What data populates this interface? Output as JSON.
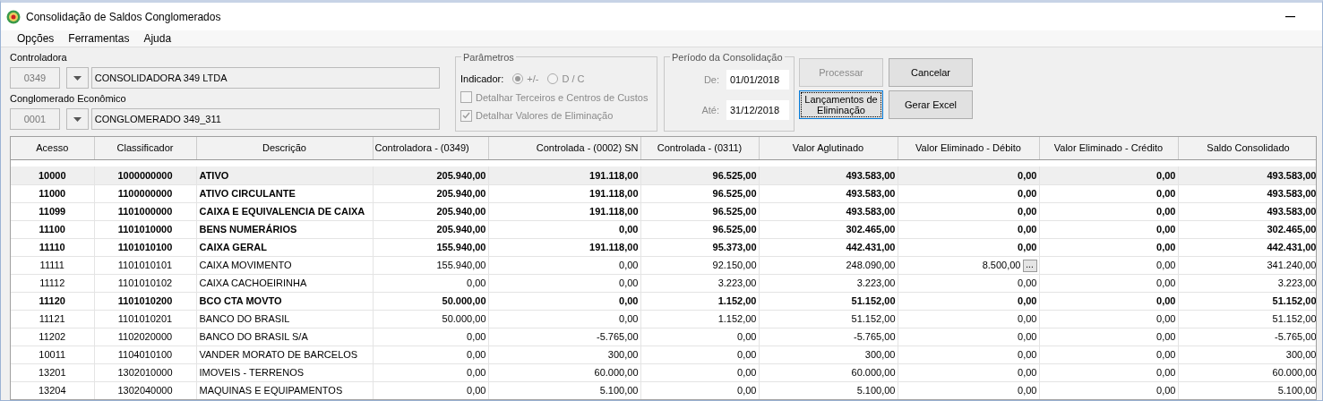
{
  "window": {
    "title": "Consolidação de Saldos Conglomerados"
  },
  "menu": [
    {
      "label": "Opções"
    },
    {
      "label": "Ferramentas"
    },
    {
      "label": "Ajuda"
    }
  ],
  "controladora": {
    "label": "Controladora",
    "code": "0349",
    "name": "CONSOLIDADORA 349 LTDA"
  },
  "conglomerado": {
    "label": "Conglomerado Econômico",
    "code": "0001",
    "name": "CONGLOMERADO 349_311"
  },
  "parametros": {
    "legend": "Parâmetros",
    "indicator_label": "Indicador:",
    "radios": [
      {
        "label": "+/-",
        "selected": true,
        "disabled": true
      },
      {
        "label": "D / C",
        "selected": false,
        "disabled": true
      }
    ],
    "checkboxes": [
      {
        "label": "Detalhar Terceiros e Centros de Custos",
        "checked": false,
        "disabled": true
      },
      {
        "label": "Detalhar Valores de Eliminação",
        "checked": true,
        "disabled": true
      }
    ]
  },
  "periodo": {
    "legend": "Período da Consolidação",
    "from_label": "De:",
    "from": "01/01/2018",
    "to_label": "Até:",
    "to": "31/12/2018"
  },
  "buttons": [
    {
      "label": "Processar",
      "disabled": true,
      "focused": false
    },
    {
      "label": "Cancelar",
      "disabled": false,
      "focused": false
    },
    {
      "label": "Lançamentos de Eliminação",
      "disabled": false,
      "focused": true
    },
    {
      "label": "Gerar Excel",
      "disabled": false,
      "focused": false
    }
  ],
  "table": {
    "columns": [
      "Acesso",
      "Classificador",
      "Descrição",
      "Controladora - (0349)",
      "Controlada - (0002) SN",
      "Controlada - (0311)",
      "Valor Aglutinado",
      "Valor Eliminado - Débito",
      "Valor Eliminado - Crédito",
      "Saldo Consolidado"
    ],
    "rows": [
      {
        "bold": true,
        "selected": true,
        "cells": [
          "10000",
          "1000000000",
          "ATIVO",
          "205.940,00",
          "191.118,00",
          "96.525,00",
          "493.583,00",
          "0,00",
          "0,00",
          "493.583,00"
        ]
      },
      {
        "bold": true,
        "selected": false,
        "cells": [
          "11000",
          "1100000000",
          "ATIVO CIRCULANTE",
          "205.940,00",
          "191.118,00",
          "96.525,00",
          "493.583,00",
          "0,00",
          "0,00",
          "493.583,00"
        ]
      },
      {
        "bold": true,
        "selected": false,
        "cells": [
          "11099",
          "1101000000",
          "CAIXA E EQUIVALENCIA DE CAIXA",
          "205.940,00",
          "191.118,00",
          "96.525,00",
          "493.583,00",
          "0,00",
          "0,00",
          "493.583,00"
        ]
      },
      {
        "bold": true,
        "selected": false,
        "cells": [
          "11100",
          "1101010000",
          "BENS NUMERÁRIOS",
          "205.940,00",
          "0,00",
          "96.525,00",
          "302.465,00",
          "0,00",
          "0,00",
          "302.465,00"
        ]
      },
      {
        "bold": true,
        "selected": false,
        "cells": [
          "11110",
          "1101010100",
          "CAIXA GERAL",
          "155.940,00",
          "191.118,00",
          "95.373,00",
          "442.431,00",
          "0,00",
          "0,00",
          "442.431,00"
        ]
      },
      {
        "bold": false,
        "selected": false,
        "detail_button": "...",
        "cells": [
          "11111",
          "1101010101",
          "CAIXA MOVIMENTO",
          "155.940,00",
          "0,00",
          "92.150,00",
          "248.090,00",
          "8.500,00",
          "0,00",
          "341.240,00"
        ]
      },
      {
        "bold": false,
        "selected": false,
        "cells": [
          "11112",
          "1101010102",
          "CAIXA CACHOEIRINHA",
          "0,00",
          "0,00",
          "3.223,00",
          "3.223,00",
          "0,00",
          "0,00",
          "3.223,00"
        ]
      },
      {
        "bold": true,
        "selected": false,
        "cells": [
          "11120",
          "1101010200",
          "BCO CTA MOVTO",
          "50.000,00",
          "0,00",
          "1.152,00",
          "51.152,00",
          "0,00",
          "0,00",
          "51.152,00"
        ]
      },
      {
        "bold": false,
        "selected": false,
        "cells": [
          "11121",
          "1101010201",
          "BANCO DO BRASIL",
          "50.000,00",
          "0,00",
          "1.152,00",
          "51.152,00",
          "0,00",
          "0,00",
          "51.152,00"
        ]
      },
      {
        "bold": false,
        "selected": false,
        "cells": [
          "11202",
          "1102020000",
          "BANCO DO BRASIL S/A",
          "0,00",
          "-5.765,00",
          "0,00",
          "-5.765,00",
          "0,00",
          "0,00",
          "-5.765,00"
        ]
      },
      {
        "bold": false,
        "selected": false,
        "cells": [
          "10011",
          "1104010100",
          "VANDER MORATO DE BARCELOS",
          "0,00",
          "300,00",
          "0,00",
          "300,00",
          "0,00",
          "0,00",
          "300,00"
        ]
      },
      {
        "bold": false,
        "selected": false,
        "cells": [
          "13201",
          "1302010000",
          "IMOVEIS - TERRENOS",
          "0,00",
          "60.000,00",
          "0,00",
          "60.000,00",
          "0,00",
          "0,00",
          "60.000,00"
        ]
      },
      {
        "bold": false,
        "selected": false,
        "cells": [
          "13204",
          "1302040000",
          "MAQUINAS E EQUIPAMENTOS",
          "0,00",
          "5.100,00",
          "0,00",
          "5.100,00",
          "0,00",
          "0,00",
          "5.100,00"
        ]
      }
    ]
  }
}
